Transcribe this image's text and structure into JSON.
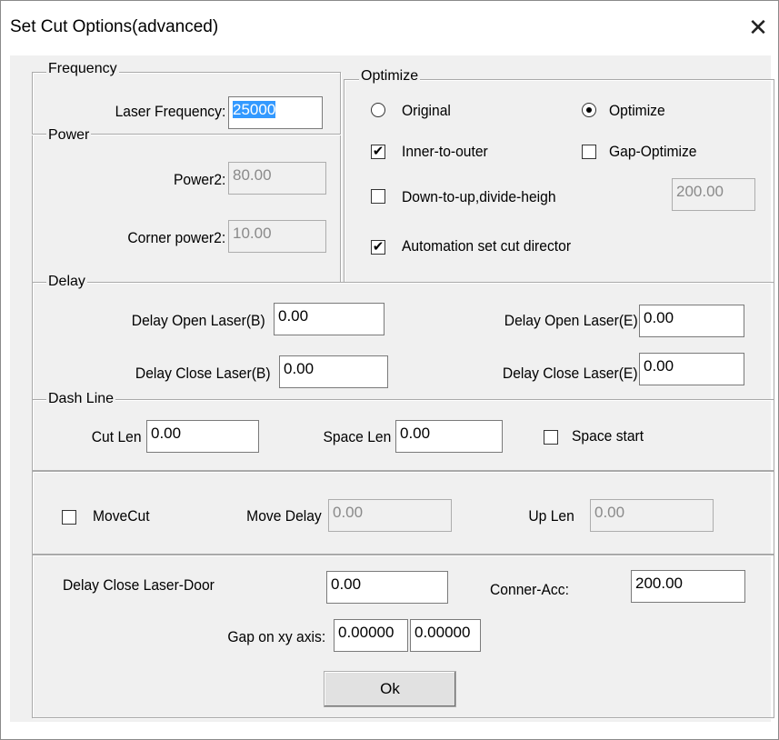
{
  "window": {
    "title": "Set Cut Options(advanced)",
    "close_glyph": "✕"
  },
  "frequency": {
    "title": "Frequency",
    "laser_label": "Laser Frequency:",
    "laser_value": "25000"
  },
  "power": {
    "title": "Power",
    "power2_label": "Power2:",
    "power2_value": "80.00",
    "corner_label": "Corner power2:",
    "corner_value": "10.00"
  },
  "optimize": {
    "title": "Optimize",
    "original_label": "Original",
    "original_selected": false,
    "optimize_label": "Optimize",
    "optimize_selected": true,
    "inner_label": "Inner-to-outer",
    "inner_checked": true,
    "gap_label": "Gap-Optimize",
    "gap_checked": false,
    "down_label": "Down-to-up,divide-heigh",
    "down_checked": false,
    "down_value": "200.00",
    "auto_label": "Automation set cut director",
    "auto_checked": true,
    "check_glyph": "✔"
  },
  "delay": {
    "title": "Delay",
    "open_b_label": "Delay Open Laser(B)",
    "open_b_value": "0.00",
    "open_e_label": "Delay Open Laser(E)",
    "open_e_value": "0.00",
    "close_b_label": "Delay Close Laser(B)",
    "close_b_value": "0.00",
    "close_e_label": "Delay Close Laser(E)",
    "close_e_value": "0.00"
  },
  "dash": {
    "title": "Dash Line",
    "cut_len_label": "Cut Len",
    "cut_len_value": "0.00",
    "space_len_label": "Space Len",
    "space_len_value": "0.00",
    "space_start_label": "Space start",
    "space_start_checked": false
  },
  "move": {
    "movecut_label": "MoveCut",
    "movecut_checked": false,
    "move_delay_label": "Move Delay",
    "move_delay_value": "0.00",
    "up_len_label": "Up Len",
    "up_len_value": "0.00"
  },
  "bottom": {
    "door_label": "Delay Close Laser-Door",
    "door_value": "0.00",
    "acc_label": "Conner-Acc:",
    "acc_value": "200.00",
    "gap_label": "Gap on xy axis:",
    "gap_x_value": "0.00000",
    "gap_y_value": "0.00000",
    "ok_label": "Ok"
  }
}
